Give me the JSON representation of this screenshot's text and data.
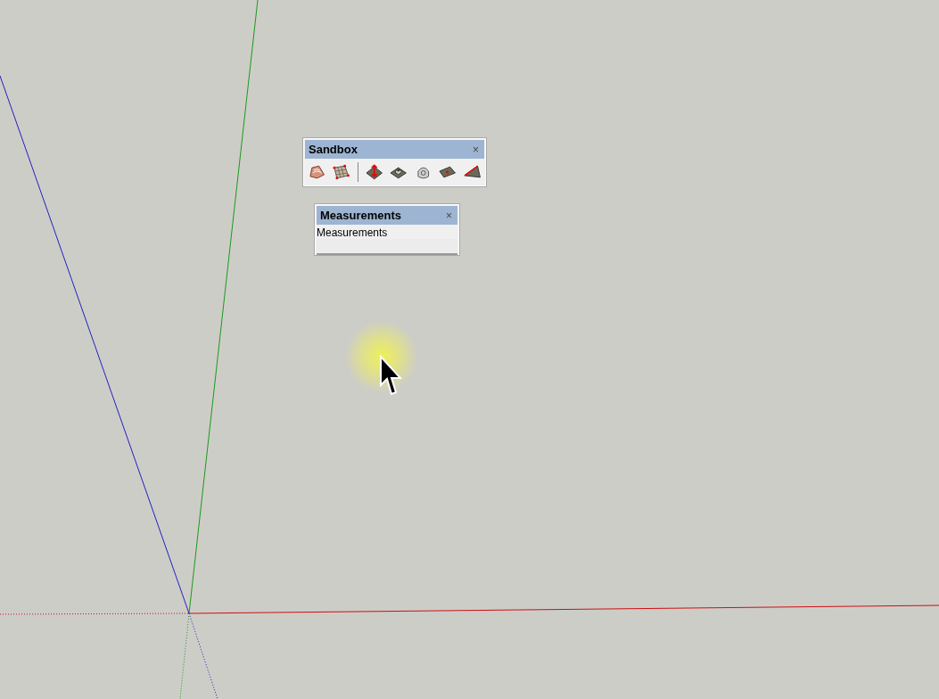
{
  "toolbars": [
    {
      "title": "Sandbox",
      "close": "×"
    },
    {
      "title": "Measurements",
      "close": "×",
      "label": "Measurements"
    }
  ]
}
